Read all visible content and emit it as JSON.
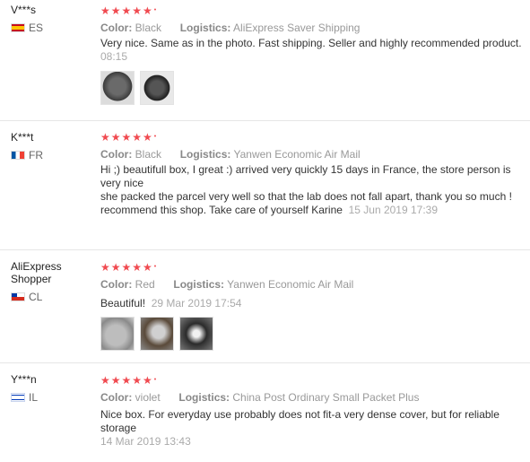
{
  "reviews": [
    {
      "user": "V***s",
      "country": "ES",
      "stars": "★★★★★",
      "star_extra": "•",
      "color_label": "Color:",
      "color": "Black",
      "logistics_label": "Logistics:",
      "logistics": "AliExpress Saver Shipping",
      "text": "Very nice. Same as in the photo. Fast shipping. Seller and highly recommended product.",
      "date": "08:15",
      "photos": [
        "photo-1",
        "photo-2"
      ]
    },
    {
      "user": "K***t",
      "country": "FR",
      "stars": "★★★★★",
      "star_extra": "•",
      "color_label": "Color:",
      "color": "Black",
      "logistics_label": "Logistics:",
      "logistics": "Yanwen Economic Air Mail",
      "text": "Hi ;) beautifull box, I great :) arrived very quickly 15 days in France, the store person is very nice\nshe packed the parcel very well so that the lab does not fall apart, thank you so much !\nrecommend this shop. Take care of yourself Karine",
      "date": "15 Jun 2019 17:39"
    },
    {
      "user": "AliExpress Shopper",
      "country": "CL",
      "stars": "★★★★★",
      "star_extra": "•",
      "color_label": "Color:",
      "color": "Red",
      "logistics_label": "Logistics:",
      "logistics": "Yanwen Economic Air Mail",
      "text": "Beautiful!",
      "date": "29 Mar 2019 17:54",
      "photos": [
        "photo-1",
        "photo-2",
        "photo-3"
      ]
    },
    {
      "user": "Y***n",
      "country": "IL",
      "stars": "★★★★★",
      "star_extra": "•",
      "color_label": "Color:",
      "color": "violet",
      "logistics_label": "Logistics:",
      "logistics": "China Post Ordinary Small Packet Plus",
      "text": "Nice box. For everyday use probably does not fit-a very dense cover, but for reliable storage",
      "date": "14 Mar 2019 13:43"
    }
  ],
  "colors": {
    "stars": "#f04a50",
    "divider": "#e6e6e6"
  }
}
